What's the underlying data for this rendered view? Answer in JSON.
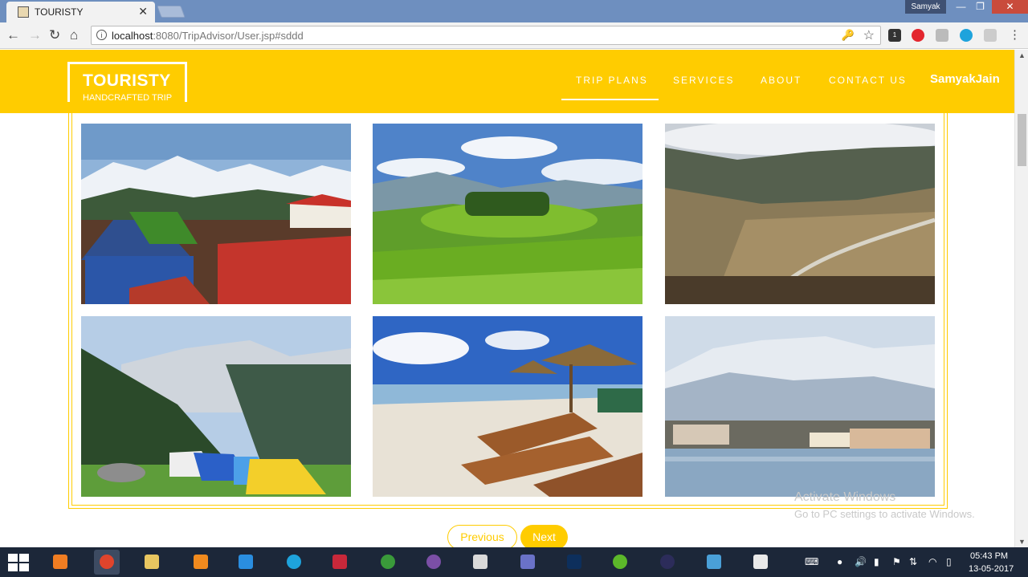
{
  "browser": {
    "tab_title": "TOURISTY",
    "tab_close": "✕",
    "profile": "Samyak",
    "window_min": "—",
    "window_max": "❐",
    "window_close": "✕",
    "url_host": "localhost",
    "url_path": ":8080/TripAdvisor/User.jsp#sddd",
    "back": "←",
    "forward": "→",
    "reload": "↻",
    "home": "⌂",
    "info": "i",
    "key": "🔑",
    "star": "☆",
    "menu": "⋮",
    "extensions": [
      "ext-icon",
      "opera-icon",
      "cube-icon",
      "skype-icon",
      "pdf-icon"
    ],
    "extension_badge": "1"
  },
  "site": {
    "logo_title": "TOURISTY",
    "logo_subtitle": "HANDCRAFTED TRIP",
    "nav": [
      "TRIP PLANS",
      "SERVICES",
      "ABOUT",
      "CONTACT US"
    ],
    "user": "SamyakJain",
    "brand_color": "#ffcc00"
  },
  "gallery": {
    "photos": [
      {
        "name": "mountain-houses-photo"
      },
      {
        "name": "tea-garden-photo"
      },
      {
        "name": "valley-town-photo"
      },
      {
        "name": "mountain-camp-photo"
      },
      {
        "name": "beach-loungers-photo"
      },
      {
        "name": "lake-houseboats-photo"
      }
    ]
  },
  "pager": {
    "previous": "Previous",
    "next": "Next"
  },
  "watermark": {
    "line1": "Activate Windows",
    "line2": "Go to PC settings to activate Windows."
  },
  "taskbar": {
    "time": "05:43 PM",
    "date": "13-05-2017",
    "apps": [
      "files-app",
      "chrome-app",
      "explorer-app",
      "vlc-app",
      "media-player-app",
      "skype-app",
      "screen-recorder-app",
      "globe-app",
      "tor-app",
      "notepad-app",
      "dolphin-app",
      "me-app",
      "dreamweaver-app",
      "eclipse-app",
      "photos-app",
      "java-app"
    ]
  }
}
